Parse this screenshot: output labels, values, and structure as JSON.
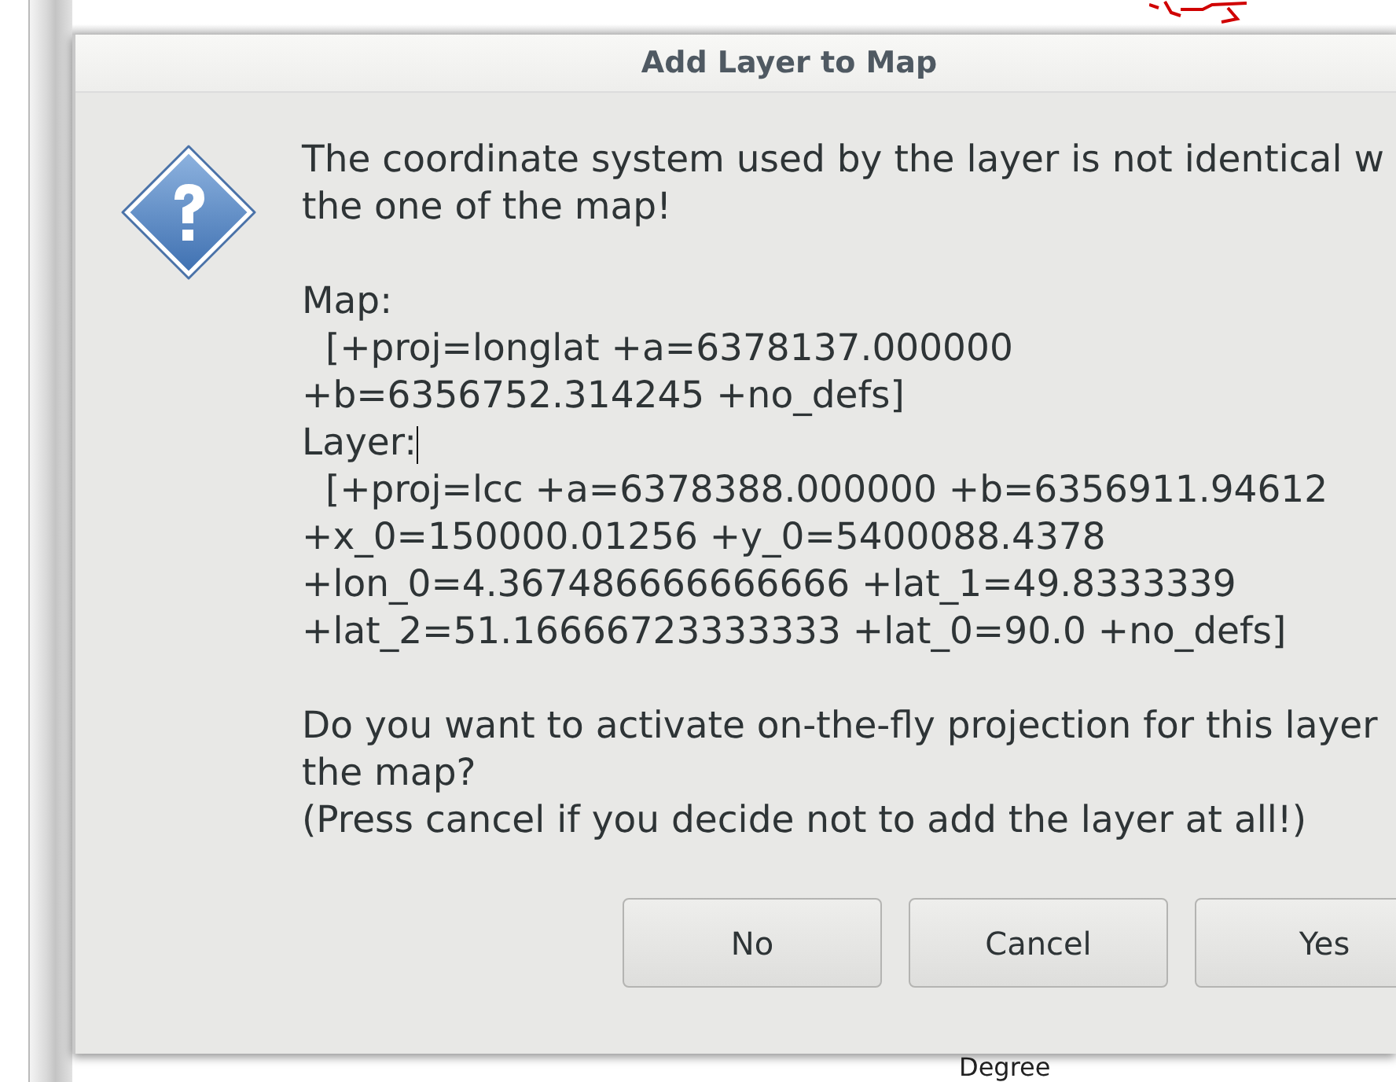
{
  "dialog": {
    "title": "Add Layer to Map",
    "paragraphs": [
      [
        "The coordinate system used by the layer is not identical w",
        "the one of the map!"
      ],
      [
        "Map:",
        "  [+proj=longlat +a=6378137.000000",
        "+b=6356752.314245 +no_defs]",
        "Layer:",
        "  [+proj=lcc +a=6378388.000000 +b=6356911.94612",
        "+x_0=150000.01256 +y_0=5400088.4378",
        "+lon_0=4.367486666666666 +lat_1=49.8333339",
        "+lat_2=51.16666723333333 +lat_0=90.0 +no_defs]"
      ],
      [
        "Do you want to activate on-the-fly projection for this layer",
        "the map?",
        "(Press cancel if you decide not to add the layer at all!)"
      ]
    ],
    "buttons": [
      "No",
      "Cancel",
      "Yes"
    ]
  },
  "background": {
    "label": "Degree"
  }
}
